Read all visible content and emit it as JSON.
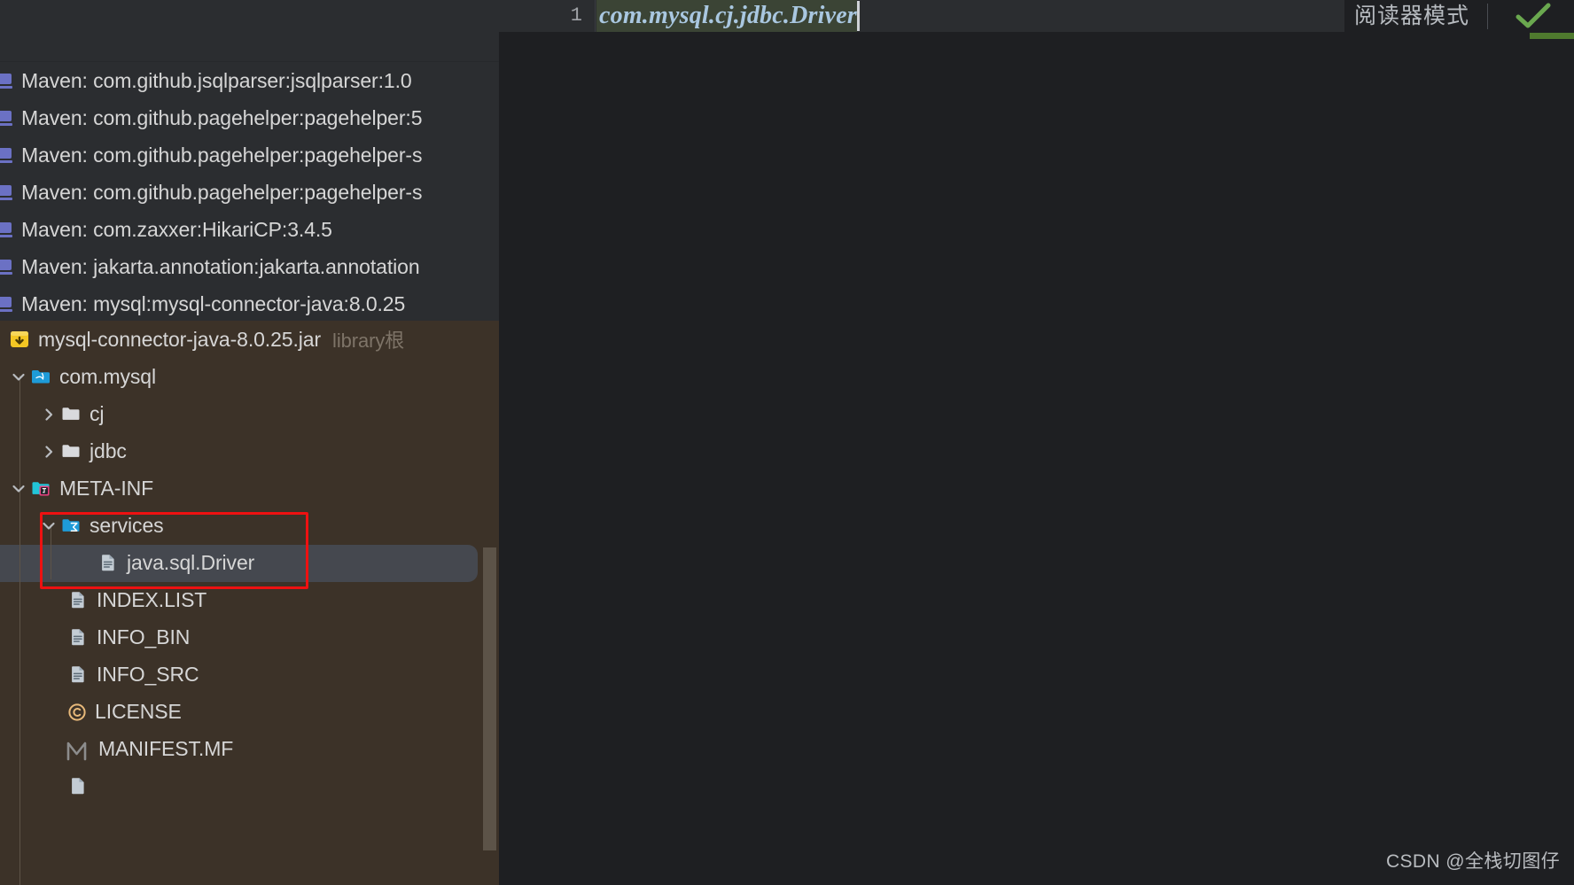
{
  "sidebar": {
    "maven_dependencies": [
      {
        "icon": "library-icon",
        "label": "Maven: com.github.jsqlparser:jsqlparser:1.0"
      },
      {
        "icon": "library-icon",
        "label": "Maven: com.github.pagehelper:pagehelper:5"
      },
      {
        "icon": "library-icon",
        "label": "Maven: com.github.pagehelper:pagehelper-s"
      },
      {
        "icon": "library-icon",
        "label": "Maven: com.github.pagehelper:pagehelper-s"
      },
      {
        "icon": "library-icon",
        "label": "Maven: com.zaxxer:HikariCP:3.4.5"
      },
      {
        "icon": "library-icon",
        "label": "Maven: jakarta.annotation:jakarta.annotation"
      },
      {
        "icon": "library-icon",
        "label": "Maven: mysql:mysql-connector-java:8.0.25"
      }
    ],
    "library_tree": {
      "jar": {
        "icon": "jar-archive-icon",
        "label": "mysql-connector-java-8.0.25.jar",
        "note": "library根"
      },
      "nodes": [
        {
          "icon": "package-mysql-icon",
          "label": "com.mysql",
          "expanded": true,
          "chevron": "chevron-down-icon"
        },
        {
          "icon": "folder-icon",
          "label": "cj",
          "expanded": false,
          "chevron": "chevron-right-icon"
        },
        {
          "icon": "folder-icon",
          "label": "jdbc",
          "expanded": false,
          "chevron": "chevron-right-icon"
        },
        {
          "icon": "folder-meta-inf-icon",
          "label": "META-INF",
          "expanded": true,
          "chevron": "chevron-down-icon"
        },
        {
          "icon": "folder-services-icon",
          "label": "services",
          "expanded": true,
          "chevron": "chevron-down-icon"
        },
        {
          "icon": "file-icon",
          "label": "java.sql.Driver",
          "selected": true
        },
        {
          "icon": "file-icon",
          "label": "INDEX.LIST"
        },
        {
          "icon": "file-icon",
          "label": "INFO_BIN"
        },
        {
          "icon": "file-icon",
          "label": "INFO_SRC"
        },
        {
          "icon": "copyright-icon",
          "label": "LICENSE"
        },
        {
          "icon": "manifest-icon",
          "label": "MANIFEST.MF"
        }
      ]
    },
    "scrollbar": {
      "name": "vertical-scrollbar"
    }
  },
  "editor": {
    "line_number": "1",
    "code": "com.mysql.cj.jdbc.Driver",
    "reader_mode_label": "阅读器模式",
    "inspection_status": "ok-checkmark"
  },
  "annotation": {
    "red_highlight_box": "services-java-sql-driver-highlight"
  },
  "watermark": {
    "text": "CSDN @全栈切图仔"
  },
  "colors": {
    "sidebar_bg": "#2b2d30",
    "library_bg": "#3c3228",
    "editor_bg": "#1e1f22",
    "selected_row": "#45484f",
    "annotation_red": "#ee1111",
    "code_highlight": "#3b4435",
    "code_text": "#a9c7e0",
    "check_green": "#6aa84f",
    "library_icon": "#6b71c4"
  }
}
